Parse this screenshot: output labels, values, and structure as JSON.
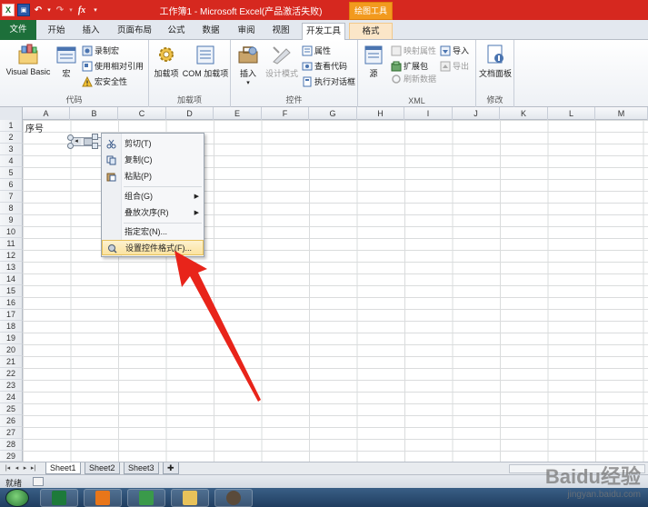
{
  "window": {
    "title": "工作簿1 - Microsoft Excel(产品激活失败)",
    "context_tab": "绘图工具"
  },
  "tabs": [
    {
      "label": "文件"
    },
    {
      "label": "开始"
    },
    {
      "label": "插入"
    },
    {
      "label": "页面布局"
    },
    {
      "label": "公式"
    },
    {
      "label": "数据"
    },
    {
      "label": "审阅"
    },
    {
      "label": "视图"
    },
    {
      "label": "开发工具"
    },
    {
      "label": "格式"
    }
  ],
  "ribbon": {
    "code_group": {
      "label": "代码",
      "visual_basic": "Visual Basic",
      "macros": "宏",
      "record_macro": "录制宏",
      "relative_ref": "使用相对引用",
      "macro_security": "宏安全性"
    },
    "addins_group": {
      "label": "加载项",
      "addins": "加载项",
      "com_addins": "COM 加载项"
    },
    "controls_group": {
      "label": "控件",
      "insert": "插入",
      "design_mode": "设计模式",
      "properties": "属性",
      "view_code": "查看代码",
      "run_dialog": "执行对话框"
    },
    "xml_group": {
      "label": "XML",
      "source": "源",
      "map_properties": "映射属性",
      "expansion_packs": "扩展包",
      "refresh_data": "刷新数据",
      "import": "导入",
      "export": "导出"
    },
    "modify_group": {
      "label": "修改",
      "document_panel": "文档面板"
    }
  },
  "sheet": {
    "columns": [
      "A",
      "B",
      "C",
      "D",
      "E",
      "F",
      "G",
      "H",
      "I",
      "J",
      "K",
      "L",
      "M"
    ],
    "rows": [
      "1",
      "2",
      "3",
      "4",
      "5",
      "6",
      "7",
      "8",
      "9",
      "10",
      "11",
      "12",
      "13",
      "14",
      "15",
      "16",
      "17",
      "18",
      "19",
      "20",
      "21",
      "22",
      "23",
      "24",
      "25",
      "26",
      "27",
      "28",
      "29"
    ],
    "cell_a1": "序号"
  },
  "context_menu": {
    "items": [
      {
        "label": "剪切(T)",
        "icon": "scissors-icon"
      },
      {
        "label": "复制(C)",
        "icon": "copy-icon"
      },
      {
        "label": "粘贴(P)",
        "icon": "paste-icon"
      },
      {
        "label": "组合(G)",
        "icon": ""
      },
      {
        "label": "叠放次序(R)",
        "icon": ""
      },
      {
        "label": "指定宏(N)...",
        "icon": ""
      },
      {
        "label": "设置控件格式(F)...",
        "icon": "format-control-icon"
      }
    ]
  },
  "sheet_tabs": [
    "Sheet1",
    "Sheet2",
    "Sheet3"
  ],
  "status": {
    "text": "就绪"
  },
  "watermark": {
    "brand": "Baidu经验",
    "url": "jingyan.baidu.com"
  },
  "colors": {
    "title_bar": "#d6281f",
    "file_tab": "#1d6f3a",
    "context_tab": "#f29a1e",
    "annotation_arrow": "#e8241a"
  }
}
